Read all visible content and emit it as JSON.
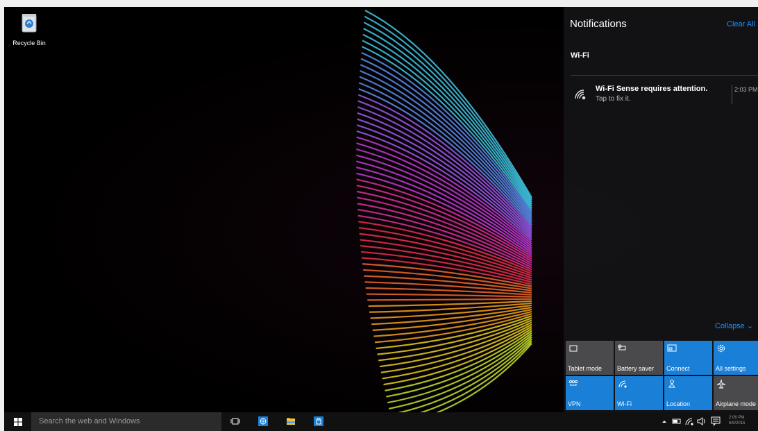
{
  "desktop": {
    "icons": [
      {
        "label": "Recycle Bin",
        "icon": "recycle-bin-icon"
      }
    ]
  },
  "action_center": {
    "title": "Notifications",
    "clear_all": "Clear All",
    "group": "Wi-Fi",
    "notification": {
      "title": "Wi-Fi Sense requires attention.",
      "body": "Tap to fix it.",
      "time": "2:03 PM",
      "icon": "wifi-icon"
    },
    "collapse": "Collapse",
    "quick_actions": [
      {
        "label": "Tablet mode",
        "icon": "tablet-mode-icon",
        "active": false
      },
      {
        "label": "Battery saver",
        "icon": "battery-saver-icon",
        "active": false
      },
      {
        "label": "Connect",
        "icon": "connect-icon",
        "active": true
      },
      {
        "label": "All settings",
        "icon": "gear-icon",
        "active": true
      },
      {
        "label": "VPN",
        "icon": "vpn-icon",
        "active": true
      },
      {
        "label": "Wi-Fi",
        "icon": "wifi-icon",
        "active": true
      },
      {
        "label": "Location",
        "icon": "location-icon",
        "active": true
      },
      {
        "label": "Airplane mode",
        "icon": "airplane-icon",
        "active": false
      }
    ]
  },
  "taskbar": {
    "search_placeholder": "Search the web and Windows",
    "pinned": [
      {
        "name": "task-view",
        "icon": "task-view-icon"
      },
      {
        "name": "edge",
        "icon": "globe-icon"
      },
      {
        "name": "file-explorer",
        "icon": "folder-icon"
      },
      {
        "name": "store",
        "icon": "store-icon"
      }
    ],
    "tray_icons": [
      "chevron-up-icon",
      "battery-icon",
      "wifi-icon",
      "volume-icon",
      "action-center-icon"
    ],
    "clock_time": "2:06 PM",
    "clock_date": "6/9/2015"
  },
  "colors": {
    "accent": "#1a7fd6",
    "link": "#1e90ff",
    "tile_off": "#4a4a4c"
  }
}
